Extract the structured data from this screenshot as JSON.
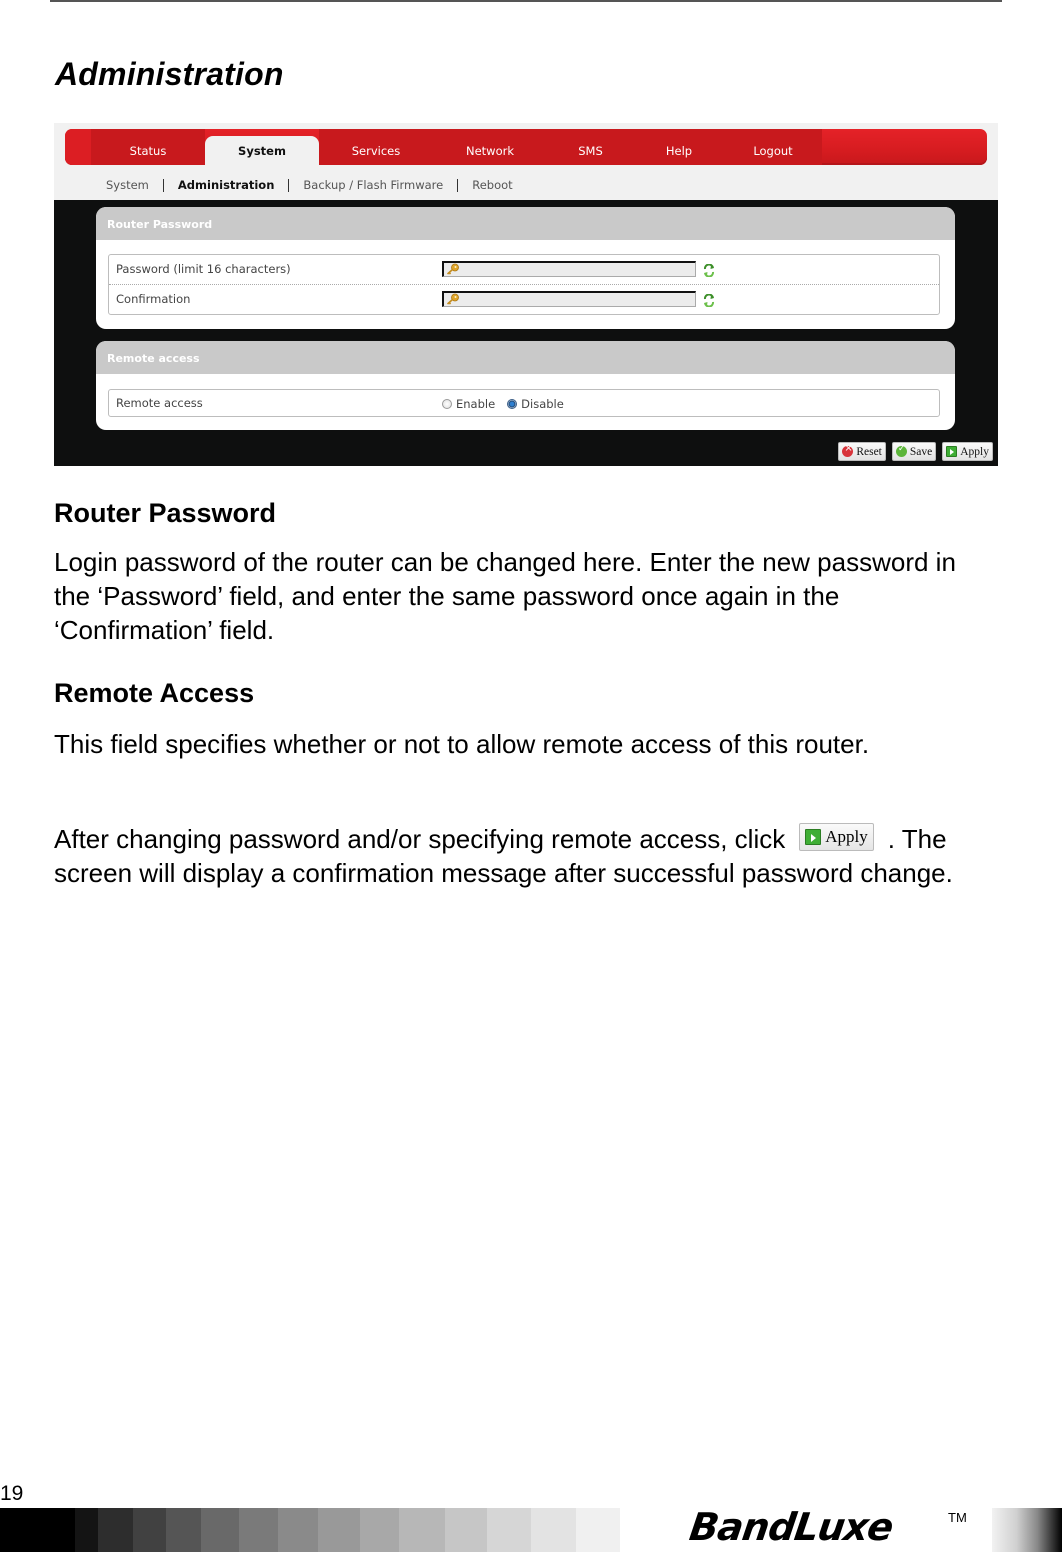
{
  "page": {
    "title": "Administration",
    "page_number": "19"
  },
  "router_ui": {
    "main_nav": [
      {
        "label": "Status",
        "active": false
      },
      {
        "label": "System",
        "active": true
      },
      {
        "label": "Services",
        "active": false
      },
      {
        "label": "Network",
        "active": false
      },
      {
        "label": "SMS",
        "active": false
      },
      {
        "label": "Help",
        "active": false
      },
      {
        "label": "Logout",
        "active": false
      }
    ],
    "sub_nav": [
      {
        "label": "System",
        "active": false
      },
      {
        "label": "Administration",
        "active": true
      },
      {
        "label": "Backup / Flash Firmware",
        "active": false
      },
      {
        "label": "Reboot",
        "active": false
      }
    ],
    "router_password": {
      "title": "Router Password",
      "password_label": "Password (limit 16 characters)",
      "password_value": "",
      "confirmation_label": "Confirmation",
      "confirmation_value": ""
    },
    "remote_access": {
      "title": "Remote access",
      "label": "Remote access",
      "options": [
        "Enable",
        "Disable"
      ],
      "selected": "Disable"
    },
    "buttons": {
      "reset": "Reset",
      "save": "Save",
      "apply": "Apply"
    },
    "colors": {
      "nav_red": "#d61c20",
      "panel_header": "#c9c9c9",
      "background_dark": "#0e0f0f"
    }
  },
  "sections": {
    "router_password": {
      "heading": "Router Password",
      "body": "Login password of the router can be changed here. Enter the new password in the ‘Password’ field, and enter the same password once again in the ‘Confirmation’ field."
    },
    "remote_access": {
      "heading": "Remote Access",
      "body": "This field specifies whether or not to allow remote access of this router."
    },
    "apply_note": {
      "before": "After changing password and/or specifying remote access, click",
      "button_label": "Apply",
      "after": ". The screen will display a confirmation message after successful password change."
    }
  },
  "footer": {
    "brand": "BandLuxe",
    "trademark": "TM"
  }
}
